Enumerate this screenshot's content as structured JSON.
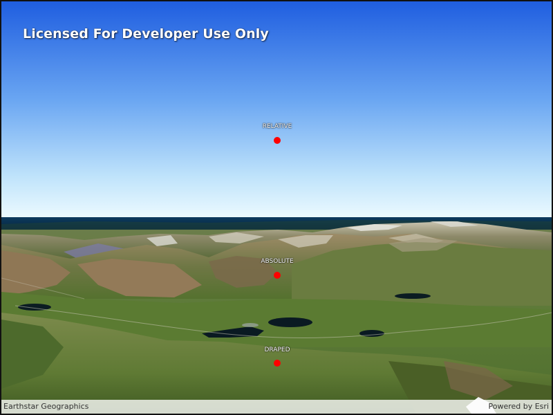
{
  "watermark": {
    "text": "Licensed For Developer Use Only"
  },
  "graphics": [
    {
      "label": "RELATIVE",
      "color": "#ff0000"
    },
    {
      "label": "ABSOLUTE",
      "color": "#ff0000"
    },
    {
      "label": "DRAPED",
      "color": "#ff0000"
    }
  ],
  "attribution": {
    "text": "Earthstar Geographics",
    "powered_by": "Powered by Esri"
  },
  "colors": {
    "sky_top": "#1f5ee0",
    "sky_horizon": "#e8f8ff",
    "sea": "#0a2a45",
    "terrain_green": "#5f8a3a",
    "terrain_brown": "#8a7450",
    "marker": "#ff0000"
  }
}
